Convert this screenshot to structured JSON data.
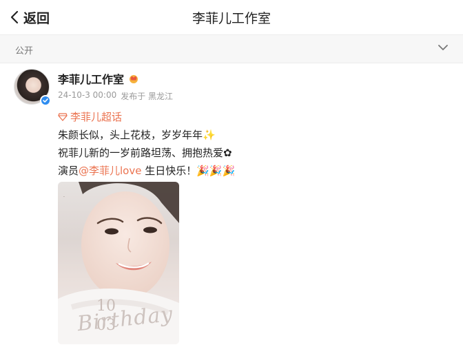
{
  "header": {
    "back_label": "返回",
    "title": "李菲儿工作室"
  },
  "filter": {
    "label": "公开"
  },
  "post": {
    "author": "李菲儿工作室",
    "date": "24-10-3 00:00",
    "source": "发布于 黑龙江",
    "topic": "李菲儿超话",
    "line1": "朱颜长似，头上花枝，岁岁年年✨",
    "line2": "祝菲儿新的一岁前路坦荡、拥抱热爱✿",
    "line3_prefix": "演员",
    "mention": "@李菲儿love",
    "line3_suffix": " 生日快乐！🎉🎉🎉",
    "image": {
      "overlay_top": "10",
      "overlay_bottom": "03",
      "overlay_script": "Birthday"
    }
  },
  "colors": {
    "accent": "#eb7350",
    "verified": "#2d8cf0"
  }
}
